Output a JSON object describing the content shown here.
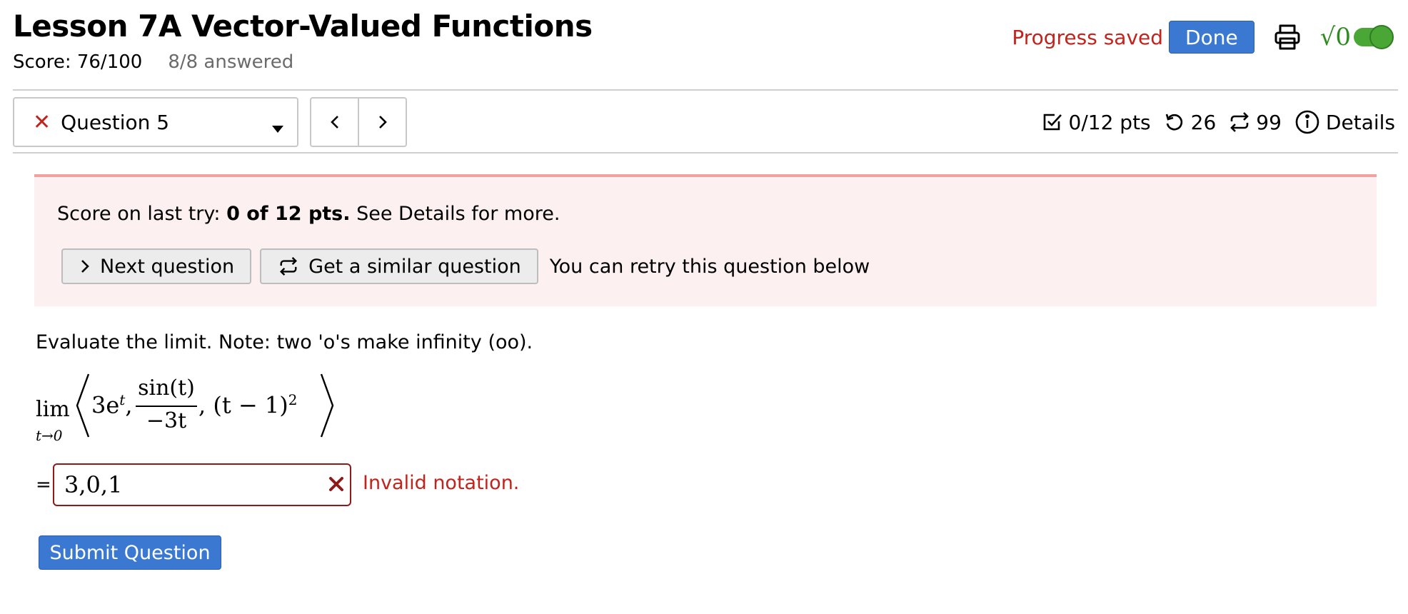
{
  "header": {
    "title": "Lesson 7A Vector-Valued Functions",
    "score": "Score: 76/100",
    "answered": "8/8 answered",
    "progress_status": "Progress saved",
    "done_label": "Done",
    "math_toggle_glyph": "√0"
  },
  "question_nav": {
    "current": "Question 5",
    "status": "incorrect",
    "points": "0/12 pts",
    "retries": "26",
    "similar_count": "99",
    "details_label": "Details"
  },
  "alert": {
    "prefix": "Score on last try: ",
    "score_bold": "0 of 12 pts.",
    "suffix": " See Details for more.",
    "next_label": "Next question",
    "similar_label": "Get a similar question",
    "retry_note": "You can retry this question below"
  },
  "question": {
    "prompt": "Evaluate the limit. Note: two 'o's make infinity (oo).",
    "math": {
      "lim": "lim",
      "lim_sub": "t→0",
      "term1_html": "3e",
      "term1_sup": "t",
      "frac_num": "sin(t)",
      "frac_den": "−3t",
      "term3": "(t − 1)",
      "term3_sup": "2"
    },
    "equals": "=",
    "answer_value": "3,0,1",
    "error_message": "Invalid notation.",
    "submit_label": "Submit Question"
  },
  "colors": {
    "accent": "#3a78d2",
    "error": "#c0241c",
    "alert_bg": "#fdf0f0",
    "toggle": "#4aa735"
  },
  "icons": {
    "print": "printer-icon",
    "incorrect": "x-mark-icon",
    "caret": "caret-down-icon",
    "prev": "chevron-left-icon",
    "next": "chevron-right-icon",
    "points": "checkbox-icon",
    "retries": "undo-icon",
    "similar": "repeat-icon",
    "details": "info-icon"
  }
}
